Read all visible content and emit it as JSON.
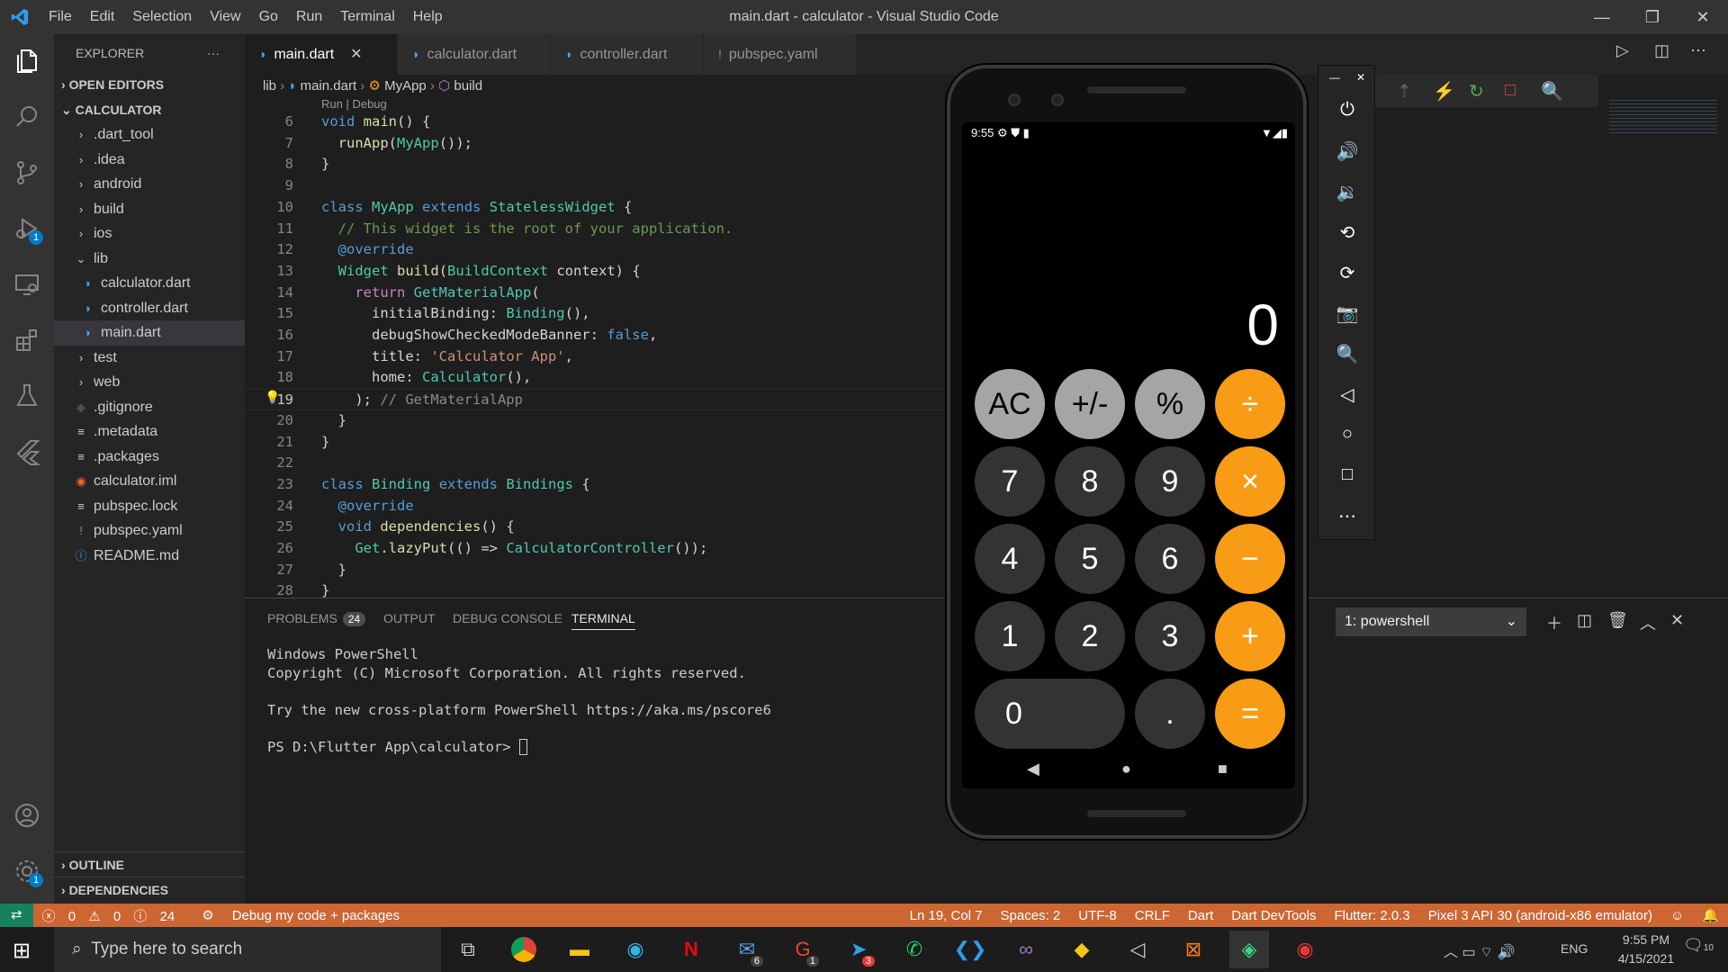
{
  "window": {
    "title": "main.dart - calculator - Visual Studio Code",
    "menu": [
      "File",
      "Edit",
      "Selection",
      "View",
      "Go",
      "Run",
      "Terminal",
      "Help"
    ]
  },
  "activity": {
    "run_badge": "1",
    "settings_badge": "1"
  },
  "sidebar": {
    "header": "EXPLORER",
    "more": "···",
    "open_editors": "OPEN EDITORS",
    "project": "CALCULATOR",
    "items": [
      {
        "label": ".dart_tool",
        "icon": "chevron-right"
      },
      {
        "label": ".idea",
        "icon": "chevron-right"
      },
      {
        "label": "android",
        "icon": "chevron-right"
      },
      {
        "label": "build",
        "icon": "chevron-right"
      },
      {
        "label": "ios",
        "icon": "chevron-right"
      },
      {
        "label": "lib",
        "icon": "chevron-down"
      },
      {
        "label": "calculator.dart",
        "icon": "dart"
      },
      {
        "label": "controller.dart",
        "icon": "dart"
      },
      {
        "label": "main.dart",
        "icon": "dart"
      },
      {
        "label": "test",
        "icon": "chevron-right"
      },
      {
        "label": "web",
        "icon": "chevron-right"
      },
      {
        "label": ".gitignore",
        "icon": "git"
      },
      {
        "label": ".metadata",
        "icon": "lines"
      },
      {
        "label": ".packages",
        "icon": "lines"
      },
      {
        "label": "calculator.iml",
        "icon": "rss"
      },
      {
        "label": "pubspec.lock",
        "icon": "lines"
      },
      {
        "label": "pubspec.yaml",
        "icon": "yaml"
      },
      {
        "label": "README.md",
        "icon": "info"
      }
    ],
    "outline": "OUTLINE",
    "dependencies": "DEPENDENCIES"
  },
  "tabs": [
    {
      "label": "main.dart",
      "active": true
    },
    {
      "label": "calculator.dart",
      "active": false
    },
    {
      "label": "controller.dart",
      "active": false
    },
    {
      "label": "pubspec.yaml",
      "active": false
    }
  ],
  "breadcrumb": {
    "p1": "lib",
    "p2": "main.dart",
    "p3": "MyApp",
    "p4": "build"
  },
  "codelens": "Run | Debug",
  "code": {
    "l6": "6",
    "l7": "7",
    "l8": "8",
    "l9": "9",
    "l10": "10",
    "l11": "11",
    "l12": "12",
    "l13": "13",
    "l14": "14",
    "l15": "15",
    "l16": "16",
    "l17": "17",
    "l18": "18",
    "l19": "19",
    "l20": "20",
    "l21": "21",
    "l22": "22",
    "l23": "23",
    "l24": "24",
    "l25": "25",
    "l26": "26",
    "l27": "27",
    "l28": "28",
    "comment11": "// This widget is the root of your application.",
    "title_str": "'Calculator App'",
    "comment19": "// GetMaterialApp"
  },
  "panel": {
    "tabs": [
      "PROBLEMS",
      "OUTPUT",
      "DEBUG CONSOLE",
      "TERMINAL"
    ],
    "problems_count": "24",
    "terminal_select": "1: powershell",
    "terminal_lines": [
      "Windows PowerShell",
      "Copyright (C) Microsoft Corporation. All rights reserved.",
      "",
      "Try the new cross-platform PowerShell https://aka.ms/pscore6",
      "",
      "PS D:\\Flutter App\\calculator> "
    ]
  },
  "status": {
    "errors": "0",
    "warnings": "0",
    "info": "24",
    "debug_mode": "Debug my code + packages",
    "position": "Ln 19, Col 7",
    "spaces": "Spaces: 2",
    "encoding": "UTF-8",
    "eol": "CRLF",
    "language": "Dart",
    "devtools": "Dart DevTools",
    "flutter": "Flutter: 2.0.3",
    "device": "Pixel 3 API 30 (android-x86 emulator)"
  },
  "phone": {
    "time": "9:55",
    "display": "0",
    "buttons": [
      [
        "AC",
        "+/-",
        "%",
        "÷"
      ],
      [
        "7",
        "8",
        "9",
        "×"
      ],
      [
        "4",
        "5",
        "6",
        "−"
      ],
      [
        "1",
        "2",
        "3",
        "+"
      ],
      [
        "0",
        ".",
        "="
      ]
    ]
  },
  "taskbar": {
    "search_placeholder": "Type here to search",
    "time": "9:55 PM",
    "date": "4/15/2021",
    "lang": "ENG",
    "notif_count": "10",
    "outlook_badge": "6",
    "gmail_badge": "1",
    "telegram_badge": "3"
  },
  "colors": {
    "accent": "#007acc",
    "status_debug": "#cc6633",
    "calc_orange": "#f89c16"
  }
}
